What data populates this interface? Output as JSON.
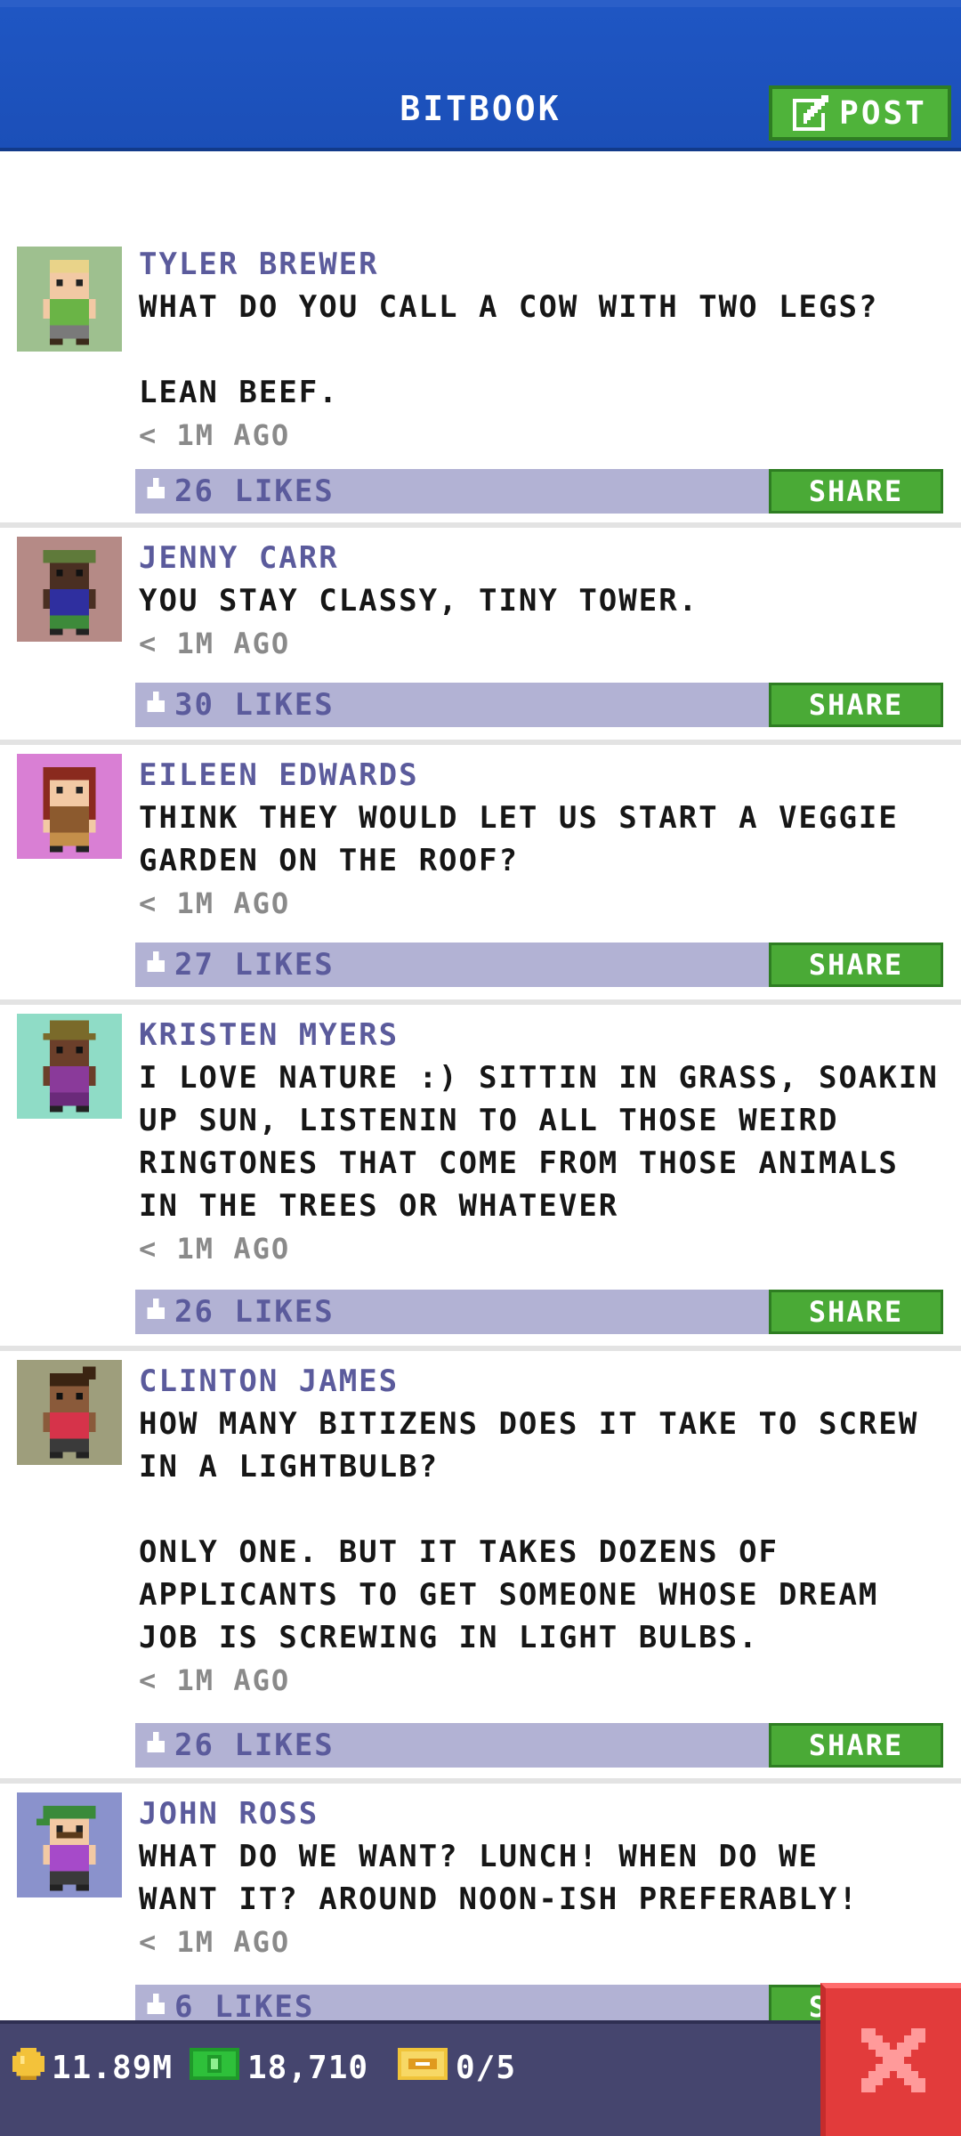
{
  "header": {
    "title": "BITBOOK",
    "post_label": "POST"
  },
  "colors": {
    "header_blue": "#1f56c3",
    "author": "#5b5b9c",
    "likes_bar": "#b2b2d4",
    "share_green": "#4aaa36",
    "bottom_bar": "#45456e",
    "close_red": "#e23b3b"
  },
  "posts": [
    {
      "author": "TYLER BREWER",
      "text": "WHAT DO YOU CALL A COW WITH TWO LEGS?\n\nLEAN BEEF.",
      "time": "< 1M AGO",
      "likes": "26 LIKES",
      "share": "SHARE",
      "avatar_icon": "bitizen-avatar-icon"
    },
    {
      "author": "JENNY CARR",
      "text": "YOU STAY CLASSY, TINY TOWER.",
      "time": "< 1M AGO",
      "likes": "30 LIKES",
      "share": "SHARE",
      "avatar_icon": "bitizen-avatar-icon"
    },
    {
      "author": "EILEEN EDWARDS",
      "text": "THINK THEY WOULD LET US START A VEGGIE\nGARDEN ON THE ROOF?",
      "time": "< 1M AGO",
      "likes": "27 LIKES",
      "share": "SHARE",
      "avatar_icon": "bitizen-avatar-icon"
    },
    {
      "author": "KRISTEN MYERS",
      "text": "I LOVE NATURE :) SITTIN IN GRASS, SOAKIN\nUP SUN, LISTENIN TO ALL THOSE WEIRD\nRINGTONES THAT COME FROM THOSE ANIMALS\nIN THE TREES OR WHATEVER",
      "time": "< 1M AGO",
      "likes": "26 LIKES",
      "share": "SHARE",
      "avatar_icon": "bitizen-avatar-icon"
    },
    {
      "author": "CLINTON JAMES",
      "text": "HOW MANY BITIZENS DOES IT TAKE TO SCREW\nIN A LIGHTBULB?\n\nONLY ONE. BUT IT TAKES DOZENS OF\nAPPLICANTS TO GET SOMEONE WHOSE DREAM\nJOB IS SCREWING IN LIGHT BULBS.",
      "time": "< 1M AGO",
      "likes": "26 LIKES",
      "share": "SHARE",
      "avatar_icon": "bitizen-avatar-icon"
    },
    {
      "author": "JOHN ROSS",
      "text": "WHAT DO WE WANT? LUNCH! WHEN DO WE\nWANT IT? AROUND NOON-ISH PREFERABLY!",
      "time": "< 1M AGO",
      "likes": "6 LIKES",
      "share": "SHARE",
      "avatar_icon": "bitizen-avatar-icon"
    }
  ],
  "status": {
    "coins": "11.89M",
    "bux": "18,710",
    "tickets": "0/5"
  }
}
